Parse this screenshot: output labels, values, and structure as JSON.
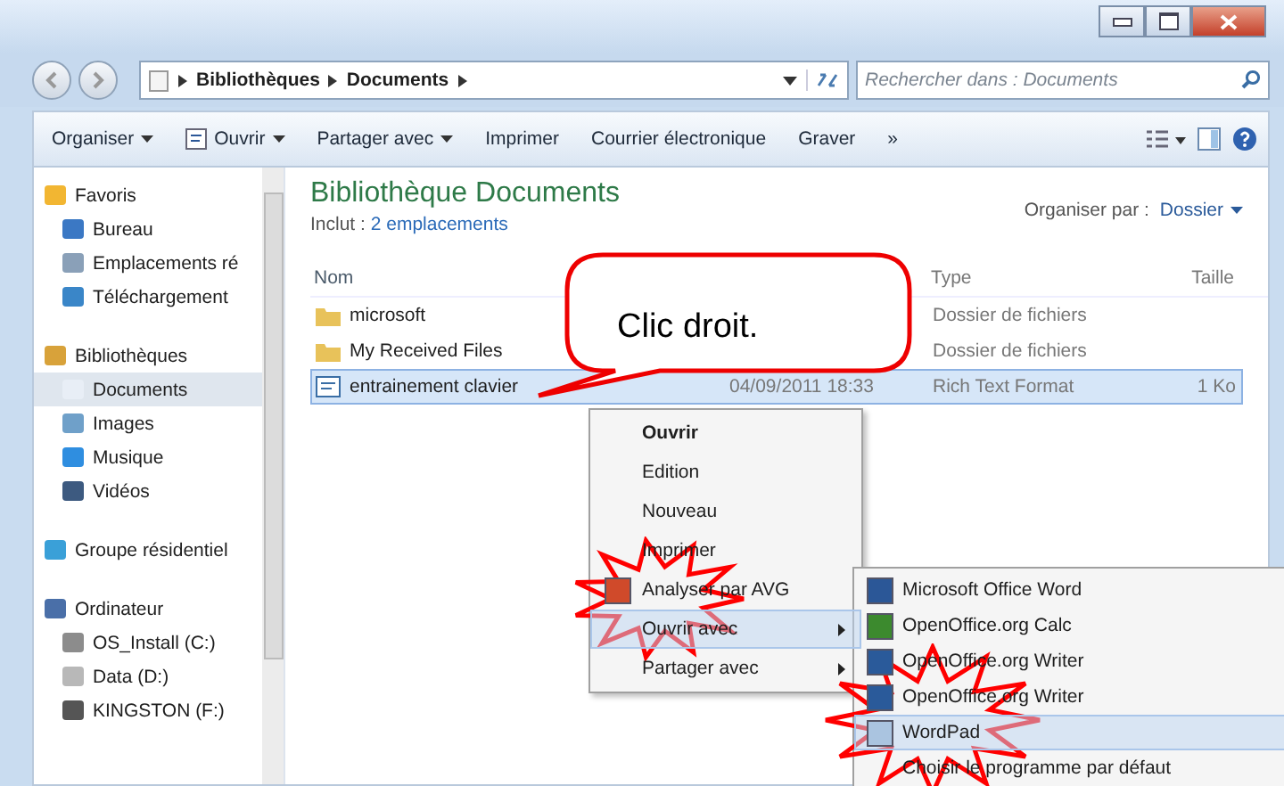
{
  "address_bar": {
    "path": [
      "Bibliothèques",
      "Documents"
    ]
  },
  "search": {
    "placeholder": "Rechercher dans : Documents"
  },
  "toolbar": {
    "items": [
      {
        "label": "Organiser",
        "dropdown": true
      },
      {
        "label": "Ouvrir",
        "dropdown": true
      },
      {
        "label": "Partager avec",
        "dropdown": true
      },
      {
        "label": "Imprimer",
        "dropdown": false
      },
      {
        "label": "Courrier électronique",
        "dropdown": false
      },
      {
        "label": "Graver",
        "dropdown": false
      },
      {
        "label": "»",
        "dropdown": false
      }
    ]
  },
  "sidebar": {
    "groups": [
      {
        "label": "Favoris",
        "items": [
          {
            "label": "Bureau",
            "selected": false
          },
          {
            "label": "Emplacements ré",
            "selected": false
          },
          {
            "label": "Téléchargement",
            "selected": false
          }
        ]
      },
      {
        "label": "Bibliothèques",
        "items": [
          {
            "label": "Documents",
            "selected": true
          },
          {
            "label": "Images",
            "selected": false
          },
          {
            "label": "Musique",
            "selected": false
          },
          {
            "label": "Vidéos",
            "selected": false
          }
        ]
      },
      {
        "label": "Groupe résidentiel"
      },
      {
        "label": "Ordinateur",
        "items": [
          {
            "label": "OS_Install (C:)",
            "selected": false
          },
          {
            "label": "Data (D:)",
            "selected": false
          },
          {
            "label": "KINGSTON (F:)",
            "selected": false
          }
        ]
      }
    ]
  },
  "library": {
    "title": "Bibliothèque Documents",
    "includes_label": "Inclut :",
    "includes_link": "2 emplacements",
    "arrange_label": "Organiser par :",
    "arrange_value": "Dossier"
  },
  "file_list": {
    "columns": [
      "Nom",
      "Type",
      "Taille"
    ],
    "rows": [
      {
        "name": "microsoft",
        "kind": "folder",
        "type": "Dossier de fichiers",
        "selected": false
      },
      {
        "name": "My Received Files",
        "kind": "folder",
        "type": "Dossier de fichiers",
        "selected": false
      },
      {
        "name": "entrainement clavier",
        "kind": "document",
        "date": "04/09/2011 18:33",
        "type": "Rich Text Format",
        "size": "1 Ko",
        "selected": true
      }
    ]
  },
  "context_menu": {
    "items": [
      {
        "label": "Ouvrir",
        "bold": true,
        "selected": false,
        "submenu": false
      },
      {
        "label": "Edition",
        "bold": false,
        "selected": false,
        "submenu": false
      },
      {
        "label": "Nouveau",
        "bold": false,
        "selected": false,
        "submenu": false
      },
      {
        "label": "Imprimer",
        "bold": false,
        "selected": false,
        "submenu": false
      },
      {
        "label": "Analyser par AVG",
        "bold": false,
        "selected": false,
        "submenu": false
      },
      {
        "label": "Ouvrir avec",
        "bold": false,
        "selected": true,
        "submenu": true
      },
      {
        "label": "Partager avec",
        "bold": false,
        "selected": false,
        "submenu": true
      }
    ]
  },
  "submenu": {
    "items": [
      {
        "label": "Microsoft Office Word",
        "selected": false
      },
      {
        "label": "OpenOffice.org Calc",
        "selected": false
      },
      {
        "label": "OpenOffice.org Writer",
        "selected": false
      },
      {
        "label": "OpenOffice.org Writer",
        "selected": false
      },
      {
        "label": "WordPad",
        "selected": true
      },
      {
        "label": "Choisir le programme par défaut",
        "selected": false
      }
    ]
  },
  "callout": {
    "text": "Clic droit."
  }
}
